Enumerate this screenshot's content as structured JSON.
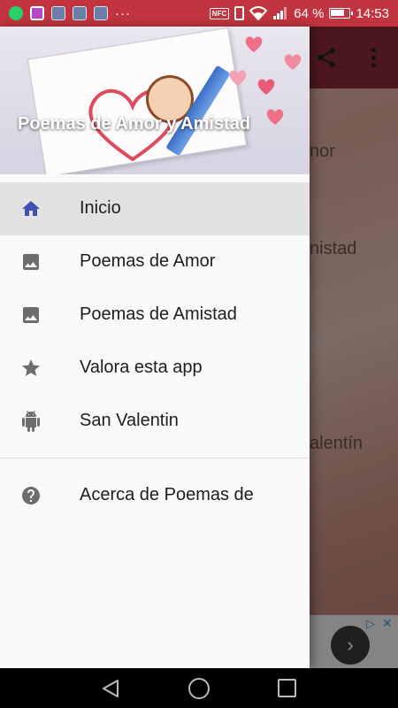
{
  "status_bar": {
    "battery_text": "64 %",
    "time": "14:53",
    "nfc_label": "NFC",
    "overflow_dots": "···"
  },
  "drawer": {
    "header_title": "Poemas de Amor y Amistad",
    "items": [
      {
        "label": "Inicio",
        "icon": "home-icon",
        "active": true
      },
      {
        "label": "Poemas de Amor",
        "icon": "image-icon"
      },
      {
        "label": "Poemas de Amistad",
        "icon": "image-icon"
      },
      {
        "label": "Valora esta app",
        "icon": "star-icon"
      },
      {
        "label": "San Valentin",
        "icon": "android-icon"
      }
    ],
    "about": {
      "label": "Acerca de Poemas de",
      "icon": "help-icon"
    }
  },
  "background_app": {
    "visible_fragments": [
      "nor",
      "nistad",
      "alentín"
    ]
  },
  "ad": {
    "next_arrow": "›",
    "close": "✕"
  },
  "colors": {
    "status_bar": "#c2343f",
    "toolbar": "#8a2a33",
    "active_item": "#e2e2e2",
    "home_icon": "#3f51b5",
    "icon_grey": "#6d6d6d"
  }
}
